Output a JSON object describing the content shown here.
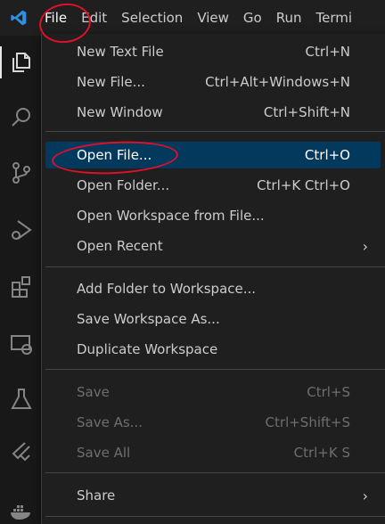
{
  "menubar": {
    "items": [
      "File",
      "Edit",
      "Selection",
      "View",
      "Go",
      "Run",
      "Termi"
    ]
  },
  "activity_icons": [
    "explorer-icon",
    "search-icon",
    "source-control-icon",
    "run-debug-icon",
    "extensions-icon",
    "remote-explorer-icon",
    "testing-icon",
    "flutter-icon",
    "docker-icon"
  ],
  "file_menu": {
    "new_text_file": {
      "label": "New Text File",
      "shortcut": "Ctrl+N"
    },
    "new_file": {
      "label": "New File...",
      "shortcut": "Ctrl+Alt+Windows+N"
    },
    "new_window": {
      "label": "New Window",
      "shortcut": "Ctrl+Shift+N"
    },
    "open_file": {
      "label": "Open File...",
      "shortcut": "Ctrl+O"
    },
    "open_folder": {
      "label": "Open Folder...",
      "shortcut": "Ctrl+K Ctrl+O"
    },
    "open_workspace": {
      "label": "Open Workspace from File..."
    },
    "open_recent": {
      "label": "Open Recent",
      "chevron": "›"
    },
    "add_folder": {
      "label": "Add Folder to Workspace..."
    },
    "save_workspace_as": {
      "label": "Save Workspace As..."
    },
    "duplicate_workspace": {
      "label": "Duplicate Workspace"
    },
    "save": {
      "label": "Save",
      "shortcut": "Ctrl+S"
    },
    "save_as": {
      "label": "Save As...",
      "shortcut": "Ctrl+Shift+S"
    },
    "save_all": {
      "label": "Save All",
      "shortcut": "Ctrl+K S"
    },
    "share": {
      "label": "Share",
      "chevron": "›"
    }
  },
  "colors": {
    "highlight": "#04395e",
    "annotation": "#e0102a",
    "vscode_blue": "#2f8fe0"
  }
}
